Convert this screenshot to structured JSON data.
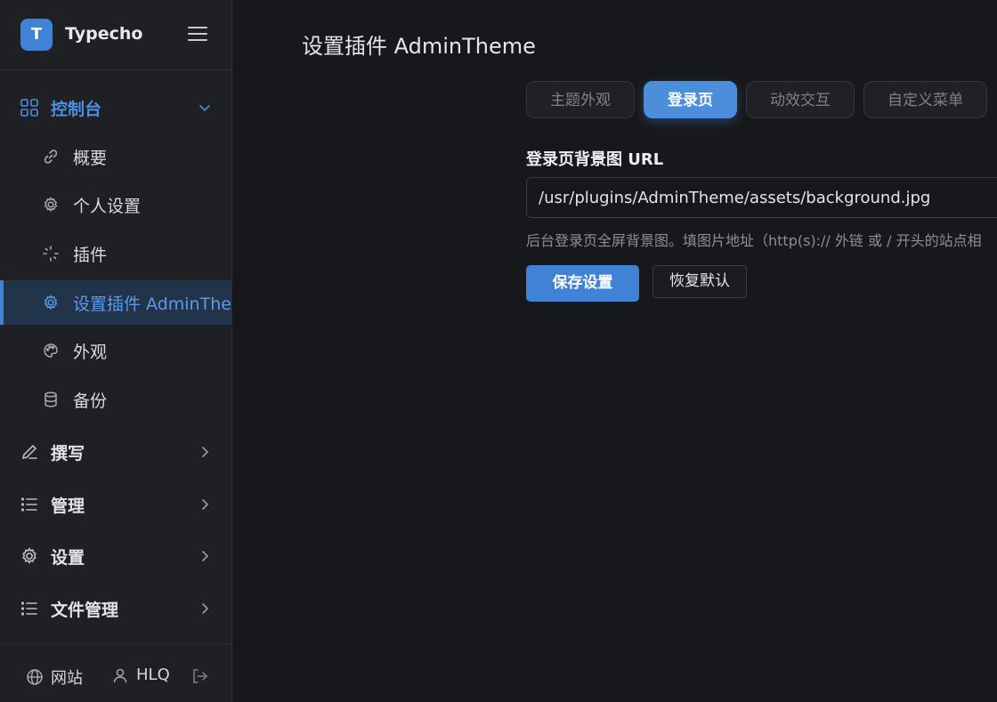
{
  "app": {
    "logo_letter": "T",
    "name": "Typecho"
  },
  "sidebar": {
    "groups": [
      {
        "label": "控制台",
        "icon": "grid-icon",
        "expanded": true
      },
      {
        "label": "撰写",
        "icon": "pen-icon"
      },
      {
        "label": "管理",
        "icon": "list-icon"
      },
      {
        "label": "设置",
        "icon": "gear-icon"
      },
      {
        "label": "文件管理",
        "icon": "list-icon"
      }
    ],
    "items": [
      {
        "label": "概要",
        "icon": "link-icon"
      },
      {
        "label": "个人设置",
        "icon": "gear-icon"
      },
      {
        "label": "插件",
        "icon": "plugin-icon"
      },
      {
        "label": "设置插件 AdminTheme",
        "icon": "gear-icon",
        "current": true
      },
      {
        "label": "外观",
        "icon": "palette-icon"
      },
      {
        "label": "备份",
        "icon": "database-icon"
      }
    ],
    "footer": {
      "site_label": "网站",
      "user_label": "HLQ"
    }
  },
  "main": {
    "title": "设置插件 AdminTheme",
    "tabs": [
      {
        "label": "主题外观"
      },
      {
        "label": "登录页",
        "active": true
      },
      {
        "label": "动效交互"
      },
      {
        "label": "自定义菜单"
      }
    ],
    "field": {
      "label": "登录页背景图 URL",
      "value": "/usr/plugins/AdminTheme/assets/background.jpg",
      "help": "后台登录页全屏背景图。填图片地址（http(s):// 外链 或 / 开头的站点相"
    },
    "save_label": "保存设置",
    "reset_label": "恢复默认"
  },
  "colors": {
    "accent": "#3f82d6",
    "background": "#17181b",
    "sidebar": "#1f2023"
  }
}
